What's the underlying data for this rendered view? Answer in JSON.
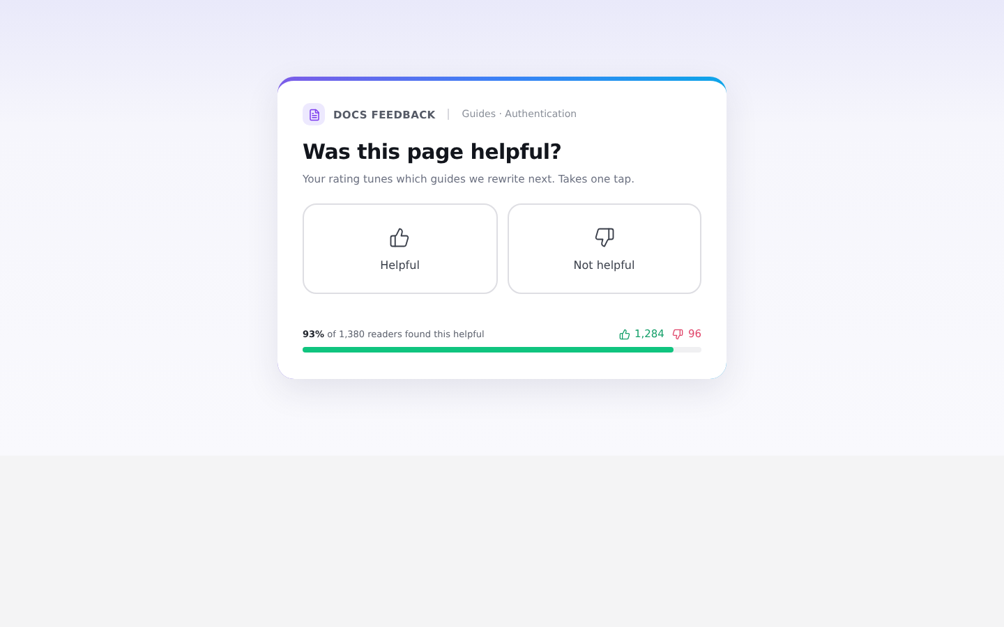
{
  "header": {
    "label": "DOCS FEEDBACK",
    "breadcrumb": "Guides · Authentication"
  },
  "title": "Was this page helpful?",
  "subtitle": "Your rating tunes which guides we rewrite next. Takes one tap.",
  "options": [
    {
      "kind": "up",
      "label": "Helpful"
    },
    {
      "kind": "down",
      "label": "Not helpful"
    }
  ],
  "summary": {
    "text": "**93%** of 1,380 readers found this helpful",
    "up_count": "1,284",
    "down_count": "96",
    "level": 0.93
  }
}
